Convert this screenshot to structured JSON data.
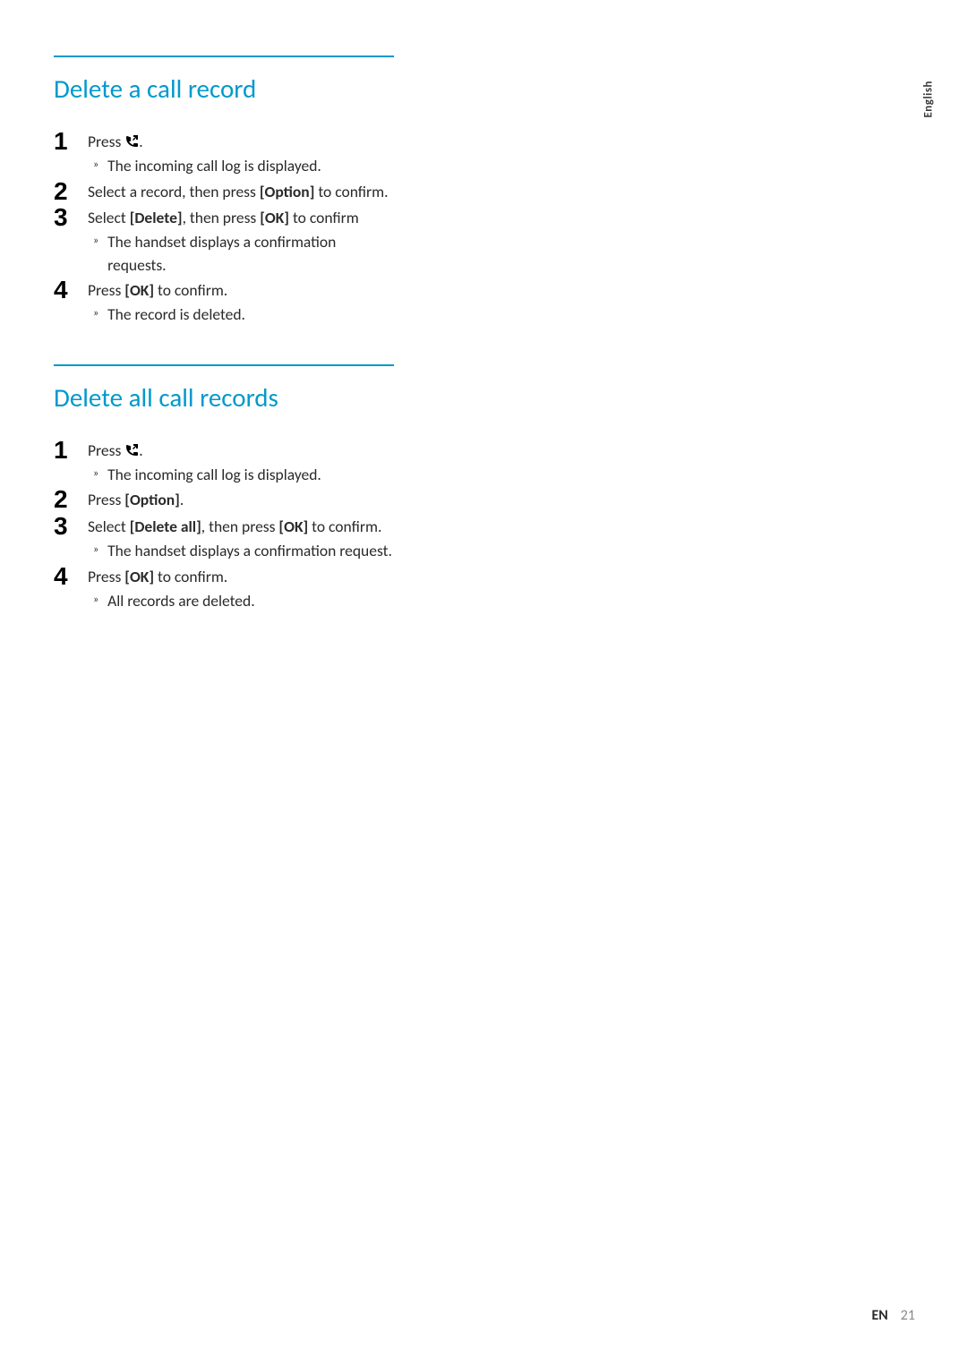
{
  "sideTab": "English",
  "sections": [
    {
      "title": "Delete a call record",
      "steps": [
        {
          "num": "1",
          "prefix": "Press ",
          "icon": true,
          "suffix": ".",
          "result": "The incoming call log is displayed."
        },
        {
          "num": "2",
          "text_parts": [
            "Select a record, then press ",
            "[Option]",
            " to confirm."
          ],
          "bold_idx": [
            1
          ]
        },
        {
          "num": "3",
          "text_parts": [
            "Select ",
            "[Delete]",
            ", then press ",
            "[OK]",
            " to confirm"
          ],
          "bold_idx": [
            1,
            3
          ],
          "result": "The handset displays a confirmation requests."
        },
        {
          "num": "4",
          "text_parts": [
            "Press ",
            "[OK]",
            " to confirm."
          ],
          "bold_idx": [
            1
          ],
          "result": "The record is deleted."
        }
      ]
    },
    {
      "title": "Delete all call records",
      "steps": [
        {
          "num": "1",
          "prefix": "Press ",
          "icon": true,
          "suffix": ".",
          "result": "The incoming call log is displayed."
        },
        {
          "num": "2",
          "text_parts": [
            "Press ",
            "[Option]",
            "."
          ],
          "bold_idx": [
            1
          ]
        },
        {
          "num": "3",
          "text_parts": [
            "Select ",
            "[Delete all]",
            ", then press ",
            "[OK]",
            " to confirm."
          ],
          "bold_idx": [
            1,
            3
          ],
          "result": "The handset displays a confirmation request."
        },
        {
          "num": "4",
          "text_parts": [
            "Press ",
            "[OK]",
            " to confirm."
          ],
          "bold_idx": [
            1
          ],
          "result": "All records are deleted."
        }
      ]
    }
  ],
  "footer": {
    "lang": "EN",
    "page": "21"
  }
}
